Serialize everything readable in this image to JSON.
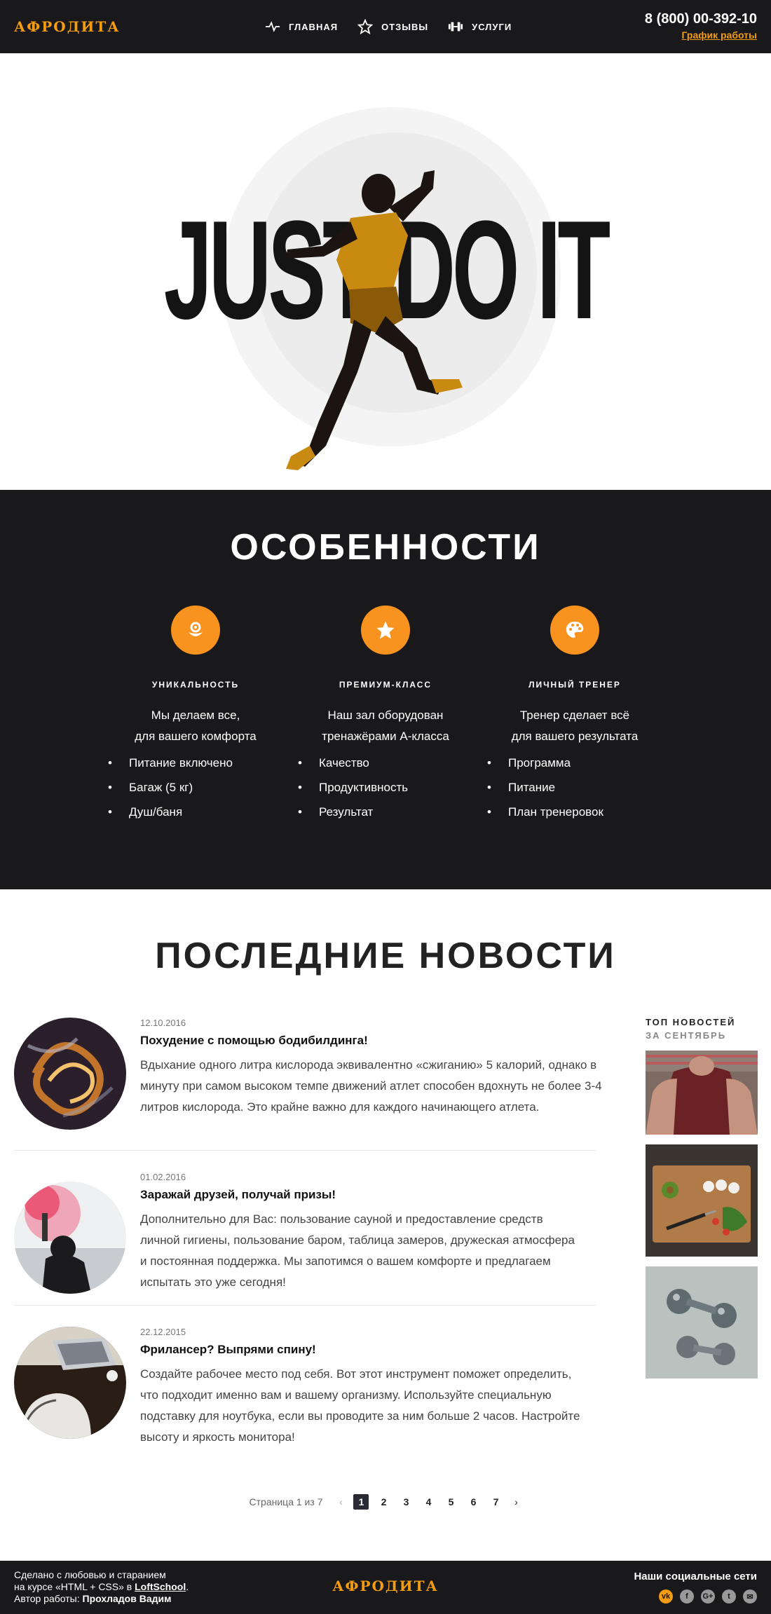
{
  "header": {
    "logo": "АФРОДИТА",
    "nav": [
      {
        "label": "ГЛАВНАЯ",
        "icon": "pulse-icon"
      },
      {
        "label": "ОТЗЫВЫ",
        "icon": "star-icon"
      },
      {
        "label": "УСЛУГИ",
        "icon": "dumbbell-icon"
      }
    ],
    "phone": "8 (800) 00-392-10",
    "schedule_link": "График работы"
  },
  "hero": {
    "headline": "JUST DO IT"
  },
  "features": {
    "title": "ОСОБЕННОСТИ",
    "items": [
      {
        "icon": "flower-icon",
        "name": "УНИКАЛЬНОСТЬ",
        "desc_line1": "Мы делаем все,",
        "desc_line2": "для вашего комфорта",
        "list": [
          "Питание включено",
          "Багаж (5 кг)",
          "Душ/баня"
        ]
      },
      {
        "icon": "star-icon",
        "name": "ПРЕМИУМ-КЛАСС",
        "desc_line1": "Наш зал оборудован",
        "desc_line2": "тренажёрами А-класса",
        "list": [
          "Качество",
          "Продуктивность",
          "Результат"
        ]
      },
      {
        "icon": "palette-icon",
        "name": "ЛИЧНЫЙ ТРЕНЕР",
        "desc_line1": "Тренер сделает всё",
        "desc_line2": "для вашего результата",
        "list": [
          "Программа",
          "Питание",
          "План тренеровок"
        ]
      }
    ]
  },
  "news": {
    "title": "ПОСЛЕДНИЕ НОВОСТИ",
    "articles": [
      {
        "date": "12.10.2016",
        "title": "Похудение с помощью бодибилдинга!",
        "text": "Вдыхание одного литра кислорода эквивалентно «сжиганию» 5 калорий, однако в минуту при самом высоком темпе движений атлет способен вдохнуть не более 3-4 литров кислорода. Это крайне важно для каждого начинающего атлета."
      },
      {
        "date": "01.02.2016",
        "title": "Заражай друзей, получай призы!",
        "text": "Дополнительно для Вас: пользование сауной и предоставление средств личной гигиены, пользование баром, таблица замеров, дружеская атмосфера и постоянная поддержка. Мы запотимся о вашем комфорте и предлагаем испытать это уже сегодня!"
      },
      {
        "date": "22.12.2015",
        "title": "Фрилансер? Выпрями спину!",
        "text": "Создайте рабочее место под себя. Вот этот инструмент поможет определить, что подходит именно вам и вашему организму. Используйте специальную подставку для ноутбука, если вы проводите за ним больше 2 часов. Настройте высоту и яркость монитора!"
      }
    ],
    "sidebar_title": "ТОП НОВОСТЕЙ",
    "sidebar_subtitle": "ЗА СЕНТЯБРЬ",
    "pager": {
      "info": "Страница 1 из 7",
      "pages": [
        "1",
        "2",
        "3",
        "4",
        "5",
        "6",
        "7"
      ],
      "prev": "‹",
      "next": "›"
    }
  },
  "footer": {
    "line1": "Сделано с любовью и старанием",
    "line2_pre": "на курсе «HTML + CSS» в ",
    "line2_link": "LoftSchool",
    "line2_post": ".",
    "line3_pre": "Автор работы: ",
    "author": "Прохладов Вадим",
    "logo": "АФРОДИТА",
    "social_title": "Наши социальные сети",
    "social": [
      {
        "icon": "vk-icon",
        "glyph": "vk"
      },
      {
        "icon": "facebook-icon",
        "glyph": "f"
      },
      {
        "icon": "google-plus-icon",
        "glyph": "G+"
      },
      {
        "icon": "twitter-icon",
        "glyph": "t"
      },
      {
        "icon": "mail-icon",
        "glyph": "✉"
      }
    ]
  },
  "colors": {
    "accent": "#f39c12",
    "dark": "#19191b"
  }
}
